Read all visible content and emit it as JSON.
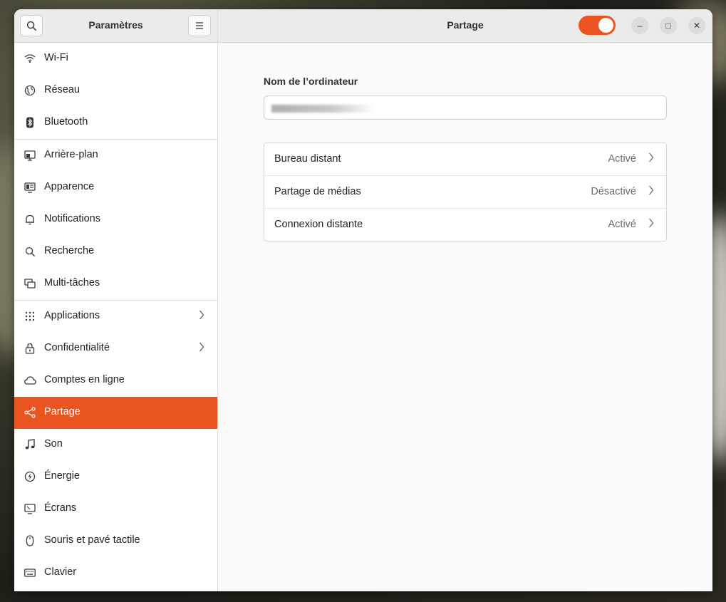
{
  "sidebar": {
    "title": "Paramètres",
    "search_icon": "search-icon",
    "menu_icon": "hamburger-menu-icon",
    "items": [
      {
        "label": "Wi-Fi",
        "icon": "wifi-icon"
      },
      {
        "label": "Réseau",
        "icon": "globe-icon"
      },
      {
        "label": "Bluetooth",
        "icon": "bluetooth-icon"
      },
      {
        "label": "Arrière-plan",
        "icon": "monitor-icon"
      },
      {
        "label": "Apparence",
        "icon": "appearance-icon"
      },
      {
        "label": "Notifications",
        "icon": "bell-icon"
      },
      {
        "label": "Recherche",
        "icon": "search-icon"
      },
      {
        "label": "Multi-tâches",
        "icon": "multitask-icon"
      },
      {
        "label": "Applications",
        "icon": "grid-icon"
      },
      {
        "label": "Confidentialité",
        "icon": "lock-icon"
      },
      {
        "label": "Comptes en ligne",
        "icon": "cloud-icon"
      },
      {
        "label": "Partage",
        "icon": "share-icon"
      },
      {
        "label": "Son",
        "icon": "music-note-icon"
      },
      {
        "label": "Énergie",
        "icon": "power-icon"
      },
      {
        "label": "Écrans",
        "icon": "display-icon"
      },
      {
        "label": "Souris et pavé tactile",
        "icon": "mouse-icon"
      },
      {
        "label": "Clavier",
        "icon": "keyboard-icon"
      }
    ],
    "active": "Partage"
  },
  "header": {
    "title": "Partage",
    "toggle_on": true,
    "minimize": "–",
    "maximize": "□",
    "close": "✕"
  },
  "main": {
    "computer_name_label": "Nom de l’ordinateur",
    "computer_name_value": "",
    "services": [
      {
        "label": "Bureau distant",
        "status": "Activé"
      },
      {
        "label": "Partage de médias",
        "status": "Désactivé"
      },
      {
        "label": "Connexion distante",
        "status": "Activé"
      }
    ]
  },
  "colors": {
    "accent": "#e95420"
  }
}
